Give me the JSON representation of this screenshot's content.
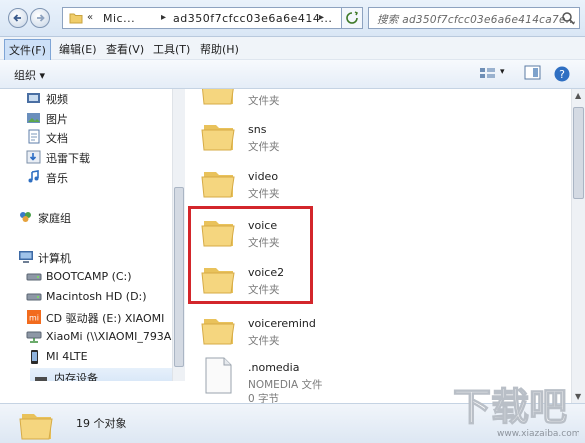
{
  "address_bar": {
    "breadcrumb_prefix": "«",
    "segments": [
      "Mic...",
      "ad350f7cfcc03e6a6e414..."
    ],
    "search_placeholder": "搜索 ad350f7cfcc03e6a6e414ca7e..."
  },
  "menu": {
    "items": [
      "文件(F)",
      "编辑(E)",
      "查看(V)",
      "工具(T)",
      "帮助(H)"
    ]
  },
  "toolbar": {
    "organize_label": "组织 ▾"
  },
  "sidebar": {
    "items": [
      {
        "label": "视频",
        "icon": "video-library-icon"
      },
      {
        "label": "图片",
        "icon": "pictures-library-icon"
      },
      {
        "label": "文档",
        "icon": "documents-library-icon"
      },
      {
        "label": "迅雷下载",
        "icon": "thunder-download-icon"
      },
      {
        "label": "音乐",
        "icon": "music-library-icon"
      },
      {
        "label": "家庭组",
        "icon": "homegroup-icon"
      },
      {
        "label": "计算机",
        "icon": "computer-icon"
      },
      {
        "label": "BOOTCAMP (C:)",
        "icon": "drive-icon"
      },
      {
        "label": "Macintosh HD (D:)",
        "icon": "drive-icon"
      },
      {
        "label": "CD 驱动器 (E:) XIAOMI",
        "icon": "xiaomi-cd-icon"
      },
      {
        "label": "XiaoMi (\\\\XIAOMI_793A)",
        "icon": "network-drive-icon"
      },
      {
        "label": "MI 4LTE",
        "icon": "phone-icon"
      },
      {
        "label": "内存设备",
        "icon": "storage-icon"
      }
    ]
  },
  "files": [
    {
      "name": "",
      "type": "文件夹",
      "icon": "folder-icon"
    },
    {
      "name": "sns",
      "type": "文件夹",
      "icon": "folder-icon"
    },
    {
      "name": "video",
      "type": "文件夹",
      "icon": "folder-icon"
    },
    {
      "name": "voice",
      "type": "文件夹",
      "icon": "folder-icon"
    },
    {
      "name": "voice2",
      "type": "文件夹",
      "icon": "folder-icon"
    },
    {
      "name": "voiceremind",
      "type": "文件夹",
      "icon": "folder-icon"
    },
    {
      "name": ".nomedia",
      "type": "NOMEDIA 文件",
      "size": "0 字节",
      "icon": "file-icon"
    }
  ],
  "status": {
    "count": "19 个对象"
  },
  "watermark": {
    "text": "下载吧",
    "url": "www.xiazaiba.com"
  },
  "colors": {
    "highlight": "#d3262b",
    "chrome": "#dde7f3",
    "folder": "#f3d37a"
  }
}
